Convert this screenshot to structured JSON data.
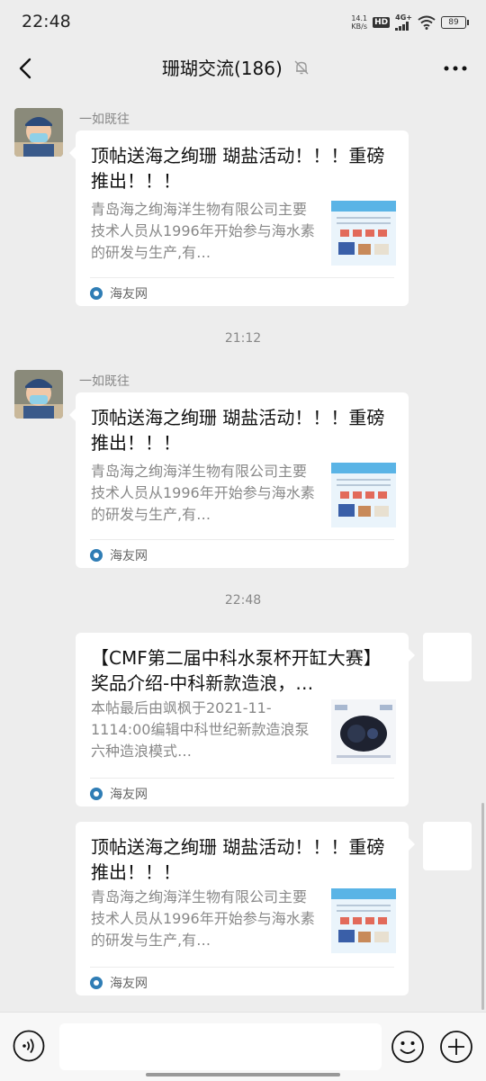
{
  "status_bar": {
    "time": "22:48",
    "net_speed_value": "14.1",
    "net_speed_unit": "KB/s",
    "hd": "HD",
    "network": "4G+",
    "battery": "89"
  },
  "header": {
    "title": "珊瑚交流(186)",
    "back_icon": "back-arrow-icon",
    "mute_icon": "bell-muted-icon",
    "more_icon": "more-dots-icon"
  },
  "messages": [
    {
      "sender": "一如既往",
      "title": "顶帖送海之绚珊 瑚盐活动！！！重磅推出！！！",
      "desc": "青岛海之绚海洋生物有限公司主要技术人员从1996年开始参与海水素的研发与生产,有…",
      "source": "海友网"
    },
    {
      "time": "21:12",
      "sender": "一如既往",
      "title": "顶帖送海之绚珊 瑚盐活动！！！重磅推出！！！",
      "desc": "青岛海之绚海洋生物有限公司主要技术人员从1996年开始参与海水素的研发与生产,有…",
      "source": "海友网"
    },
    {
      "time": "22:48",
      "title": "【CMF第二届中科水泵杯开缸大赛】奖品介绍-中科新款造浪，…",
      "desc": "本帖最后由飒枫于2021-11-1114:00编辑中科世纪新款造浪泵六种造浪模式…",
      "source": "海友网"
    },
    {
      "title": "顶帖送海之绚珊 瑚盐活动！！！重磅推出！！！",
      "desc": "青岛海之绚海洋生物有限公司主要技术人员从1996年开始参与海水素的研发与生产,有…",
      "source": "海友网"
    }
  ],
  "input_bar": {
    "voice_icon": "voice-icon",
    "emoji_icon": "emoji-icon",
    "plus_icon": "plus-icon",
    "input_value": ""
  }
}
